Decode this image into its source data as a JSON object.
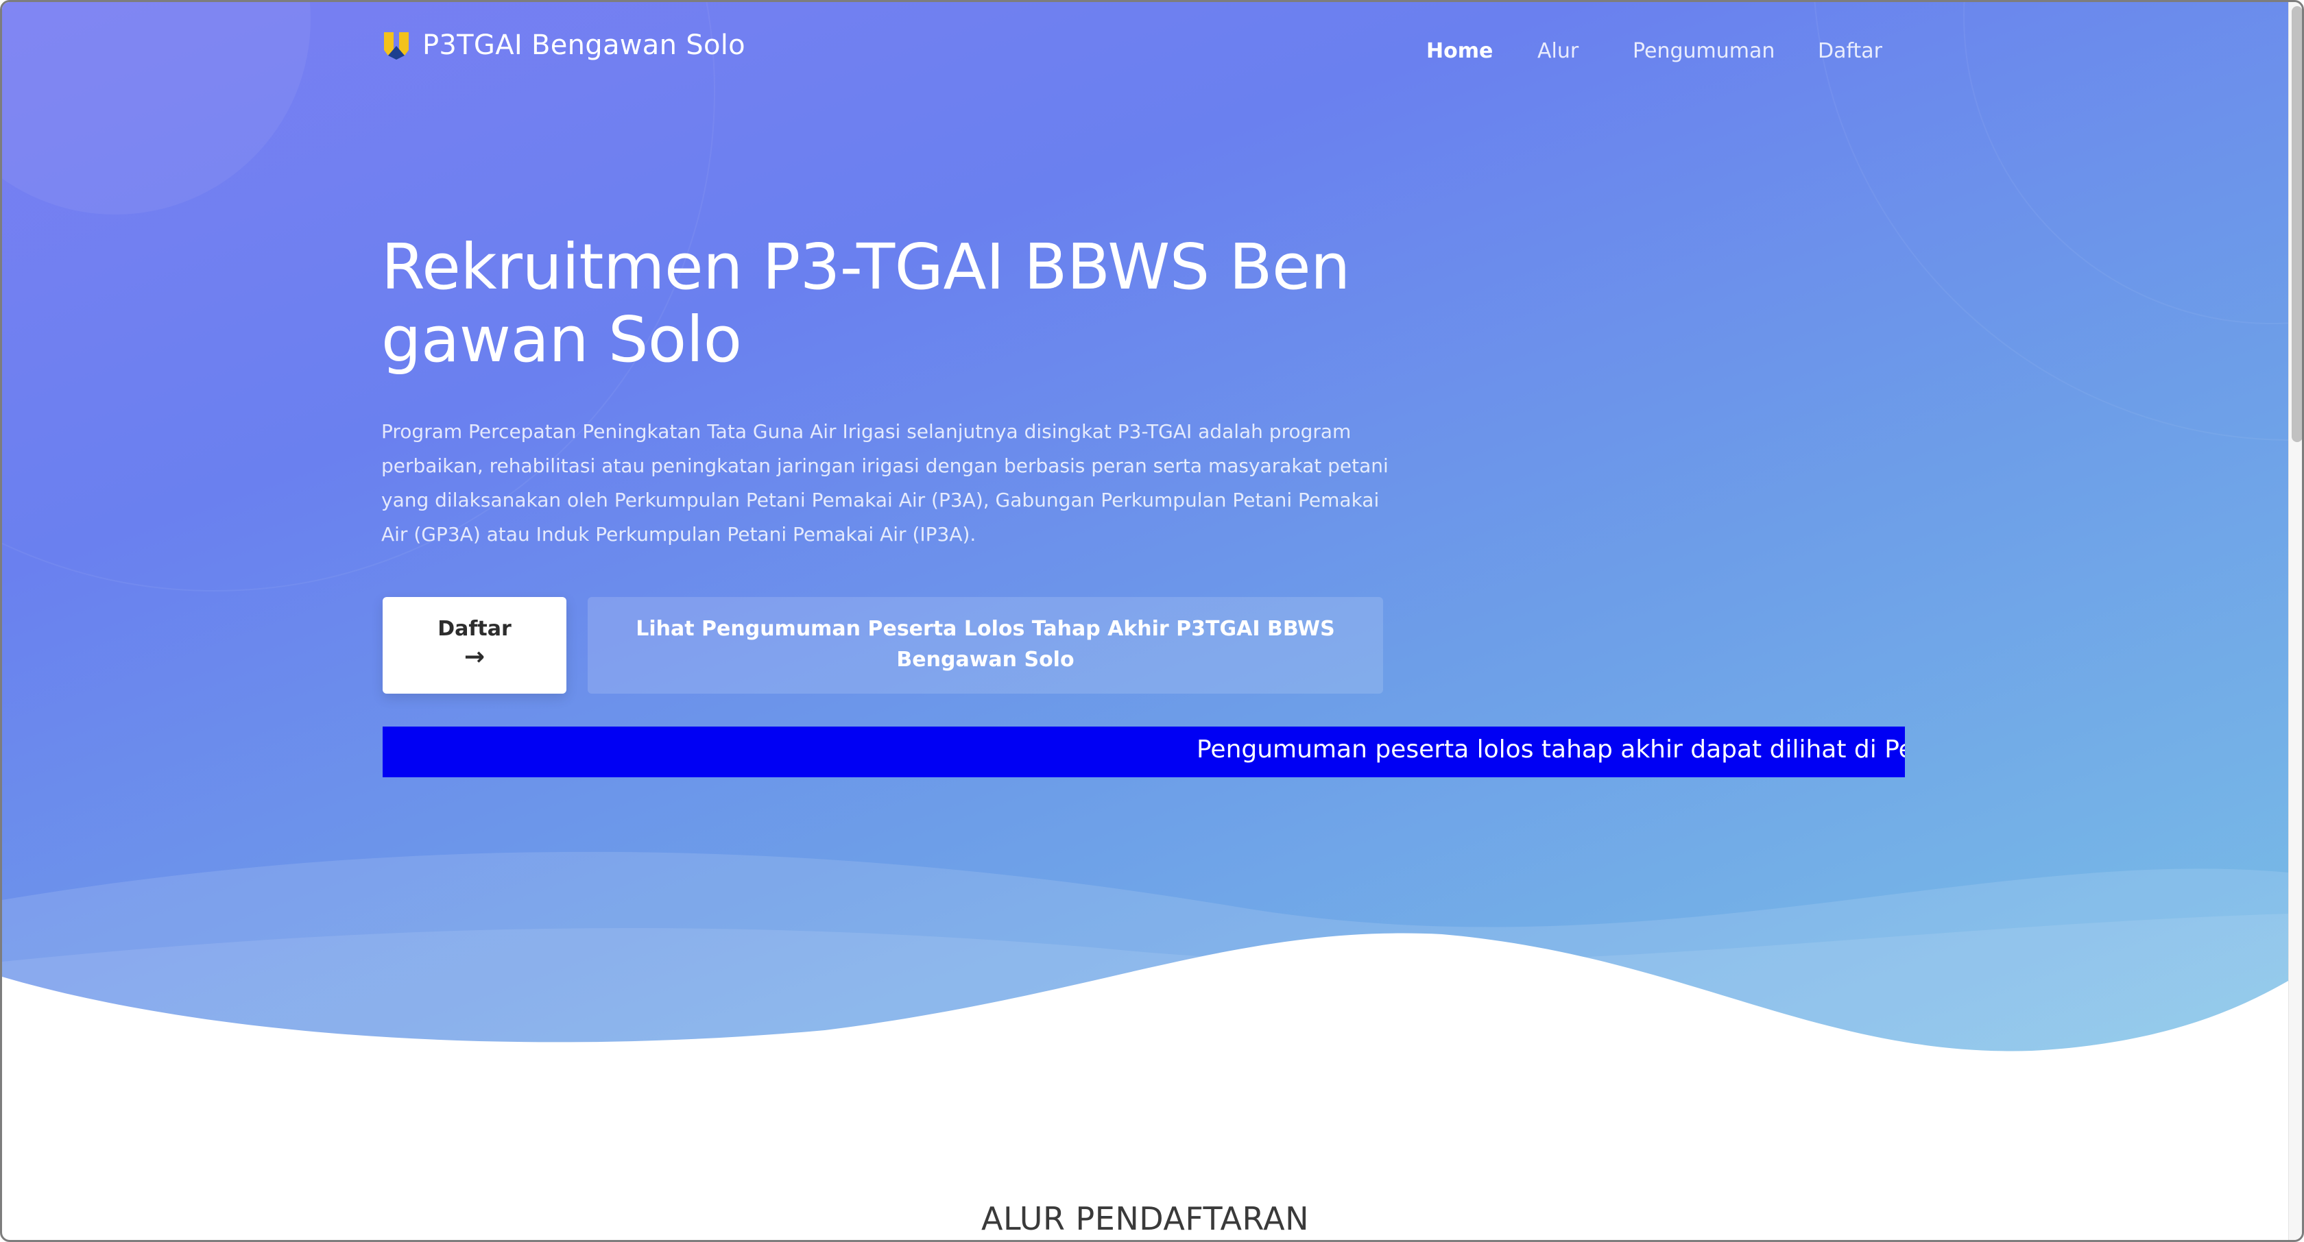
{
  "brand": {
    "name": "P3TGAI Bengawan Solo",
    "logo_icon": "pupr-logo-icon"
  },
  "nav": {
    "items": [
      {
        "label": "Home",
        "active": true
      },
      {
        "label": "Alur",
        "active": false
      },
      {
        "label": "Pengumuman",
        "active": false
      },
      {
        "label": "Daftar",
        "active": false
      }
    ]
  },
  "hero": {
    "title": "Rekruitmen P3-TGAI BBWS Bengawan Solo",
    "description": "Program Percepatan Peningkatan Tata Guna Air Irigasi selanjutnya disingkat P3-TGAI adalah program perbaikan, rehabilitasi atau peningkatan jaringan irigasi dengan berbasis peran serta masyarakat petani yang dilaksanakan oleh Perkumpulan Petani Pemakai Air (P3A), Gabungan Perkumpulan Petani Pemakai Air (GP3A) atau Induk Perkumpulan Petani Pemakai Air (IP3A).",
    "primary_button": {
      "label": "Daftar",
      "arrow": "→"
    },
    "secondary_button": {
      "label": "Lihat Pengumuman Peserta Lolos Tahap Akhir P3TGAI BBWS Bengawan Solo"
    }
  },
  "ticker": {
    "text": "Pengumuman peserta lolos tahap akhir dapat dilihat di Pengumuman",
    "background": "#0000f4"
  },
  "section": {
    "title": "ALUR PENDAFTARAN"
  },
  "colors": {
    "gradient_start": "#7a7ff3",
    "gradient_end": "#7ac0e6",
    "ticker_blue": "#0000f4"
  }
}
